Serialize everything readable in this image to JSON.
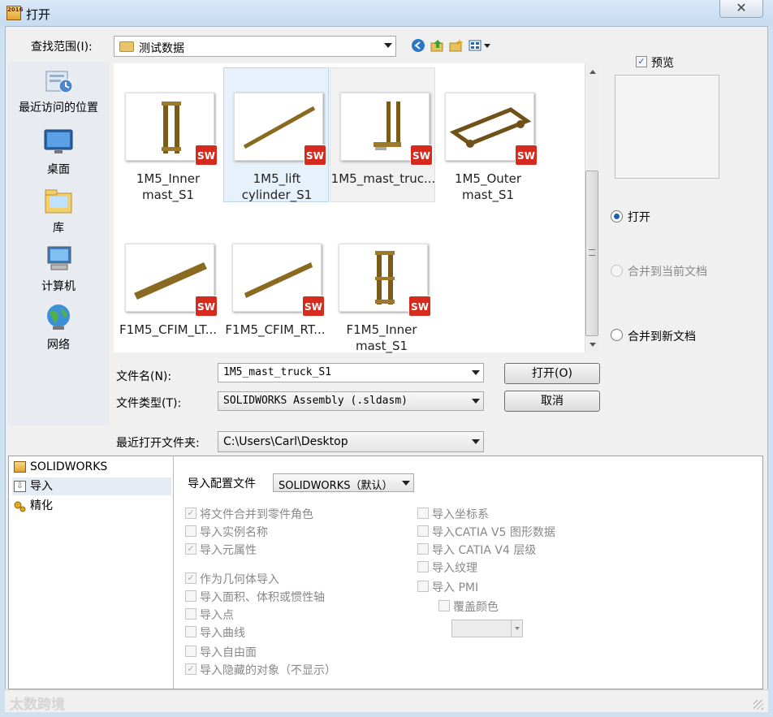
{
  "window": {
    "title": "打开",
    "close_label": "✕"
  },
  "toolbar": {
    "look_in_label": "查找范围(I):",
    "look_in_value": "测试数据",
    "back_icon": "back-arrow-icon",
    "up_icon": "up-folder-icon",
    "new_folder_icon": "new-folder-icon",
    "view_menu_icon": "view-menu-icon"
  },
  "places": [
    {
      "label": "最近访问的位置",
      "icon": "recent-places-icon"
    },
    {
      "label": "桌面",
      "icon": "desktop-icon"
    },
    {
      "label": "库",
      "icon": "libraries-icon"
    },
    {
      "label": "计算机",
      "icon": "computer-icon"
    },
    {
      "label": "网络",
      "icon": "network-icon"
    }
  ],
  "files": [
    {
      "line1": "1M5_Inner",
      "line2": "mast_S1",
      "state": "normal"
    },
    {
      "line1": "1M5_lift",
      "line2": "cylinder_S1",
      "state": "selected"
    },
    {
      "line1": "1M5_mast_truc...",
      "line2": "",
      "state": "hover"
    },
    {
      "line1": "1M5_Outer",
      "line2": "mast_S1",
      "state": "normal"
    },
    {
      "line1": "F1M5_CFIM_LT...",
      "line2": "",
      "state": "normal"
    },
    {
      "line1": "F1M5_CFIM_RT...",
      "line2": "",
      "state": "normal"
    },
    {
      "line1": "F1M5_Inner",
      "line2": "mast_S1",
      "state": "normal"
    }
  ],
  "sw_badge": "SW",
  "preview": {
    "label": "预览",
    "checked": true
  },
  "open_mode": {
    "options": [
      "打开",
      "合并到当前文档",
      "合并到新文档"
    ],
    "selected": 0
  },
  "form": {
    "filename_label": "文件名(N):",
    "filename_value": "1M5_mast_truck_S1",
    "filetype_label": "文件类型(T):",
    "filetype_value": "SOLIDWORKS Assembly (.sldasm)",
    "recent_label": "最近打开文件夹:",
    "recent_value": "C:\\Users\\Carl\\Desktop",
    "open_button": "打开(O)",
    "cancel_button": "取消"
  },
  "tree": [
    {
      "label": "SOLIDWORKS",
      "icon": "solidworks-icon"
    },
    {
      "label": "导入",
      "icon": "import-icon",
      "selected": true
    },
    {
      "label": "精化",
      "icon": "refine-icon"
    }
  ],
  "import": {
    "profile_label": "导入配置文件",
    "profile_value": "SOLIDWORKS（默认）",
    "left_options": [
      {
        "label": "将文件合并到零件角色",
        "checked": true
      },
      {
        "label": "导入实例名称",
        "checked": false
      },
      {
        "label": "导入元属性",
        "checked": true
      },
      {
        "label": "作为几何体导入",
        "checked": true
      },
      {
        "label": "导入面积、体积或惯性轴",
        "checked": false
      },
      {
        "label": "导入点",
        "checked": false
      },
      {
        "label": "导入曲线",
        "checked": false
      },
      {
        "label": "导入自由面",
        "checked": false
      },
      {
        "label": "导入隐藏的对象（不显示）",
        "checked": true
      }
    ],
    "right_options": [
      {
        "label": "导入坐标系",
        "checked": false
      },
      {
        "label": "导入CATIA V5 图形数据",
        "checked": false
      },
      {
        "label": "导入 CATIA V4 层级",
        "checked": false
      },
      {
        "label": "导入纹理",
        "checked": false
      },
      {
        "label": "导入 PMI",
        "checked": false
      },
      {
        "label": "覆盖颜色",
        "checked": false
      }
    ]
  },
  "watermark": "太数跨境"
}
